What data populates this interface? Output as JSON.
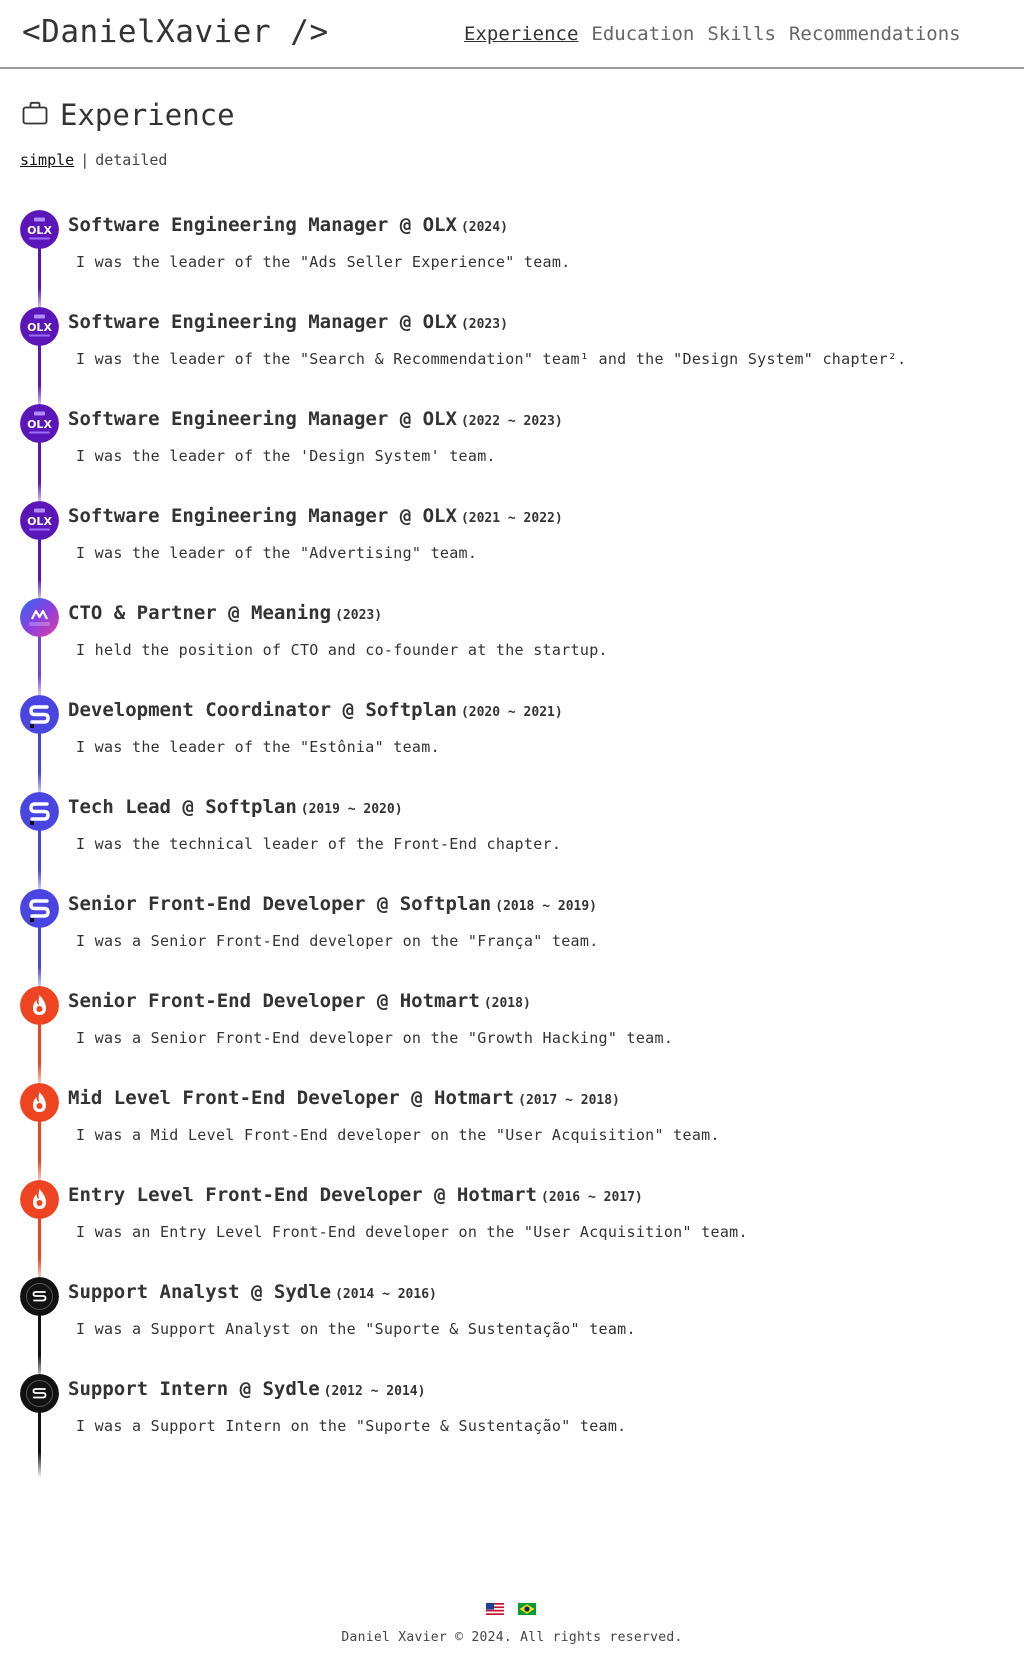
{
  "header": {
    "logo_text": "<DanielXavier />",
    "nav": [
      {
        "label": "Experience",
        "active": true
      },
      {
        "label": "Education",
        "active": false
      },
      {
        "label": "Skills",
        "active": false
      },
      {
        "label": "Recommendations",
        "active": false
      }
    ]
  },
  "section": {
    "icon": "briefcase-icon",
    "title": "Experience",
    "view_options": [
      {
        "label": "simple",
        "active": true
      },
      {
        "label": "detailed",
        "active": false
      }
    ],
    "view_separator": "|"
  },
  "experiences": [
    {
      "role": "Software Engineering Manager @ OLX",
      "period": "(2024)",
      "description": "I was the leader of the \"Ads Seller Experience\" team.",
      "company_logo": "olx-logo",
      "color": "#5a16b8"
    },
    {
      "role": "Software Engineering Manager @ OLX",
      "period": "(2023)",
      "description": "I was the leader of the \"Search & Recommendation\" team¹ and the \"Design System\" chapter².",
      "company_logo": "olx-logo",
      "color": "#5a16b8"
    },
    {
      "role": "Software Engineering Manager @ OLX",
      "period": "(2022 ~ 2023)",
      "description": "I was the leader of the 'Design System' team.",
      "company_logo": "olx-logo",
      "color": "#5a16b8"
    },
    {
      "role": "Software Engineering Manager @ OLX",
      "period": "(2021 ~ 2022)",
      "description": "I was the leader of the \"Advertising\" team.",
      "company_logo": "olx-logo",
      "color": "#5a16b8"
    },
    {
      "role": "CTO & Partner @ Meaning",
      "period": "(2023)",
      "description": "I held the position of CTO and co-founder at the startup.",
      "company_logo": "meaning-logo",
      "color": "#6b48e0",
      "logo_text": "meaning"
    },
    {
      "role": "Development Coordinator @ Softplan",
      "period": "(2020 ~ 2021)",
      "description": "I was the leader of the \"Estônia\" team.",
      "company_logo": "softplan-logo",
      "color": "#4a45e0"
    },
    {
      "role": "Tech Lead @ Softplan",
      "period": "(2019 ~ 2020)",
      "description": "I was the technical leader of the Front-End chapter.",
      "company_logo": "softplan-logo",
      "color": "#4a45e0"
    },
    {
      "role": "Senior Front-End Developer @ Softplan",
      "period": "(2018 ~ 2019)",
      "description": "I was a Senior Front-End developer on the \"França\" team.",
      "company_logo": "softplan-logo",
      "color": "#4a45e0"
    },
    {
      "role": "Senior Front-End Developer @ Hotmart",
      "period": "(2018)",
      "description": "I was a Senior Front-End developer on the \"Growth Hacking\" team.",
      "company_logo": "hotmart-logo",
      "color": "#ee4422"
    },
    {
      "role": "Mid Level Front-End Developer @ Hotmart",
      "period": "(2017 ~ 2018)",
      "description": "I was a Mid Level Front-End developer on the \"User Acquisition\" team.",
      "company_logo": "hotmart-logo",
      "color": "#ee4422"
    },
    {
      "role": "Entry Level Front-End Developer @ Hotmart",
      "period": "(2016 ~ 2017)",
      "description": "I was an Entry Level Front-End developer on the \"User Acquisition\" team.",
      "company_logo": "hotmart-logo",
      "color": "#ee4422"
    },
    {
      "role": "Support Analyst @ Sydle",
      "period": "(2014 ~ 2016)",
      "description": "I was a Support Analyst on the \"Suporte & Sustentação\" team.",
      "company_logo": "sydle-logo",
      "color": "#111111"
    },
    {
      "role": "Support Intern @ Sydle",
      "period": "(2012 ~ 2014)",
      "description": "I was a Support Intern on the \"Suporte & Sustentação\" team.",
      "company_logo": "sydle-logo",
      "color": "#111111"
    }
  ],
  "footer": {
    "languages": [
      {
        "icon": "us-flag-icon"
      },
      {
        "icon": "brazil-flag-icon"
      }
    ],
    "copyright": "Daniel Xavier © 2024. All rights reserved."
  }
}
